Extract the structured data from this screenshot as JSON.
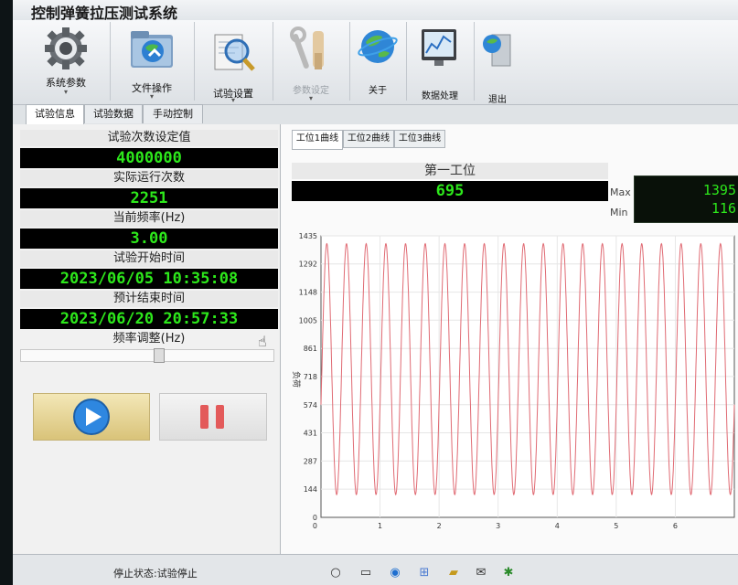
{
  "app": {
    "title": "控制弹簧拉压测试系统"
  },
  "toolbar": {
    "items": [
      {
        "label": "系统参数"
      },
      {
        "label": "文件操作"
      },
      {
        "label": "试验设置"
      },
      {
        "label": "参数设定"
      },
      {
        "label": "关于"
      },
      {
        "label": "数据处理"
      },
      {
        "label": "退出"
      }
    ]
  },
  "left_tabs": [
    {
      "label": "试验信息"
    },
    {
      "label": "试验数据"
    },
    {
      "label": "手动控制"
    }
  ],
  "info": {
    "set_count_label": "试验次数设定值",
    "set_count_value": "4000000",
    "run_count_label": "实际运行次数",
    "run_count_value": "2251",
    "freq_label": "当前频率(Hz)",
    "freq_value": "3.00",
    "start_label": "试验开始时间",
    "start_value": "2023/06/05 10:35:08",
    "end_label": "预计结束时间",
    "end_value": "2023/06/20 20:57:33",
    "freq_adjust_label": "频率调整(Hz)",
    "freq_adjust_level": 0.55
  },
  "curve_tabs": [
    {
      "label": "工位1曲线"
    },
    {
      "label": "工位2曲线"
    },
    {
      "label": "工位3曲线"
    }
  ],
  "station": {
    "title": "第一工位",
    "value": "695",
    "max_label": "Max",
    "min_label": "Min",
    "max_value": "1395",
    "min_value": "116"
  },
  "chart_data": {
    "type": "line",
    "title": "",
    "xlabel": "",
    "ylabel": "负荷",
    "ylim": [
      0,
      1435
    ],
    "y_ticks": [
      "0",
      "144",
      "287",
      "431",
      "574",
      "718",
      "861",
      "1005",
      "1148",
      "1292",
      "1435"
    ],
    "x_ticks": [
      "1",
      "2",
      "3",
      "4",
      "5",
      "6"
    ],
    "xlim": [
      0,
      7
    ],
    "series": [
      {
        "color": "#e06a73",
        "amplitude_max": 1395,
        "amplitude_min": 116,
        "frequency_hz": 3.0,
        "start_value": 574
      }
    ]
  },
  "status": {
    "text": "停止状态:试验停止"
  },
  "colors": {
    "display_green": "#2de81b",
    "display_bg": "#000000",
    "curve": "#e06a73"
  }
}
